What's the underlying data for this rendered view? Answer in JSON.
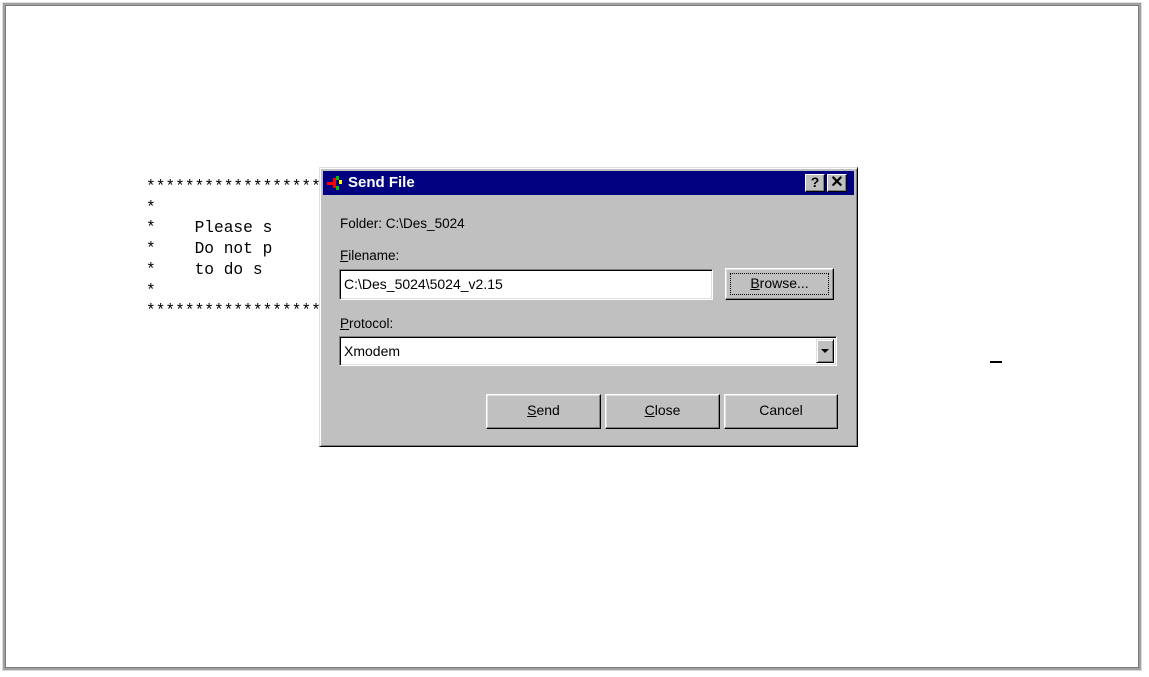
{
  "terminal": {
    "lines": [
      "***********************************************************",
      "*                                                         *",
      "*    Please s                                      ice !  *",
      "*    Do not p                                    ructed   *",
      "*    to do s                                              *",
      "*                                                         *",
      "***********************************************************"
    ]
  },
  "dialog": {
    "title": "Send File",
    "help_label": "?",
    "close_label": "✕",
    "folder_label": "Folder:",
    "folder_value": "C:\\Des_5024",
    "filename_label_key": "F",
    "filename_label_rest": "ilename:",
    "filename_value": "C:\\Des_5024\\5024_v2.15",
    "browse_key": "B",
    "browse_rest": "rowse...",
    "protocol_label_key": "P",
    "protocol_label_rest": "rotocol:",
    "protocol_value": "Xmodem",
    "send_key": "S",
    "send_rest": "end",
    "close_key": "C",
    "close_rest": "lose",
    "cancel_label": "Cancel"
  },
  "colors": {
    "titlebar": "#000080",
    "dialog_face": "#c0c0c0",
    "terminal_bg": "#ffffff"
  },
  "icons": {
    "app": "send-file-app-icon",
    "dropdown": "chevron-down-icon"
  }
}
